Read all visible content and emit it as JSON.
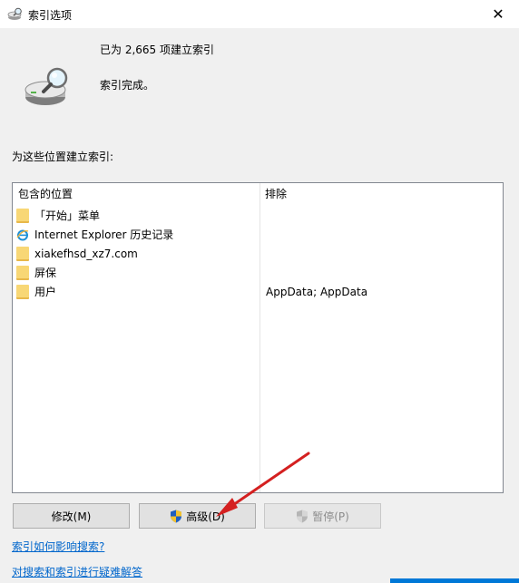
{
  "window": {
    "title": "索引选项",
    "close_glyph": "✕"
  },
  "status": {
    "count_line": "已为 2,665 项建立索引",
    "state_line": "索引完成。"
  },
  "section_label": "为这些位置建立索引:",
  "table": {
    "columns": [
      "包含的位置",
      "排除"
    ],
    "rows": [
      {
        "icon": "folder-icon",
        "location": "「开始」菜单",
        "exclude": ""
      },
      {
        "icon": "internet-explorer-icon",
        "location": "Internet Explorer 历史记录",
        "exclude": ""
      },
      {
        "icon": "folder-icon",
        "location": "xiakefhsd_xz7.com",
        "exclude": ""
      },
      {
        "icon": "folder-icon",
        "location": "屏保",
        "exclude": ""
      },
      {
        "icon": "folder-icon",
        "location": "用户",
        "exclude": "AppData; AppData"
      }
    ]
  },
  "buttons": {
    "modify": "修改(M)",
    "advanced": "高级(D)",
    "pause": "暂停(P)"
  },
  "links": {
    "how_affects": "索引如何影响搜索?",
    "troubleshoot": "对搜索和索引进行疑难解答"
  },
  "colors": {
    "link": "#0066cc",
    "annotation_arrow": "#d42020",
    "folder": "#f8d775"
  }
}
